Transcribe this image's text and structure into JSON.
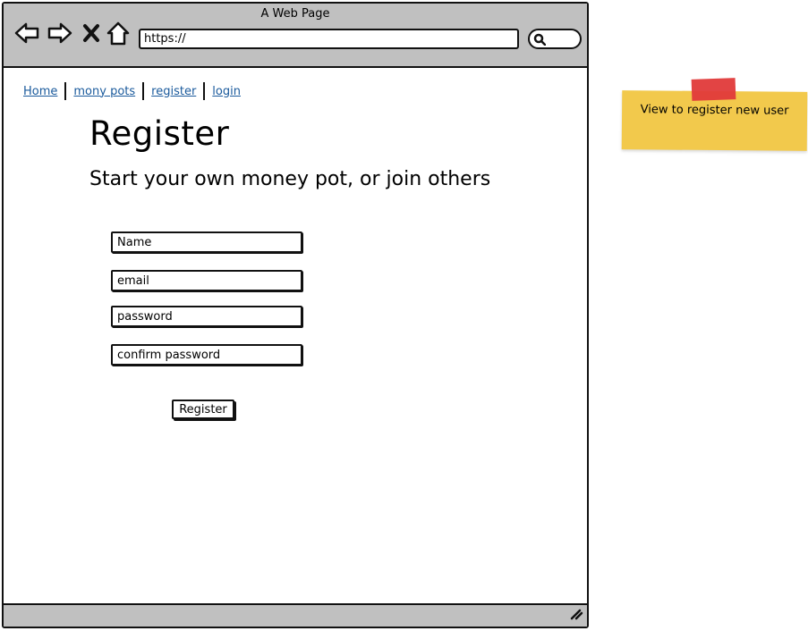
{
  "browser": {
    "title": "A Web Page",
    "url": "https://",
    "icons": [
      "back-arrow-icon",
      "forward-arrow-icon",
      "close-x-icon",
      "home-icon",
      "search-icon",
      "resize-grip-icon"
    ]
  },
  "nav": {
    "links": [
      "Home",
      "mony pots",
      "register",
      "login"
    ]
  },
  "page": {
    "title": "Register",
    "subtitle": "Start your own money pot, or join others"
  },
  "form": {
    "name_placeholder": "Name",
    "email_placeholder": "email",
    "password_placeholder": "password",
    "confirm_placeholder": "confirm password",
    "submit_label": "Register"
  },
  "note": {
    "text": "View to register new user"
  },
  "colors": {
    "chrome": "#c0c0c0",
    "link": "#1a5a9c",
    "note": "#f2c94c",
    "tape": "#e03a3a"
  }
}
